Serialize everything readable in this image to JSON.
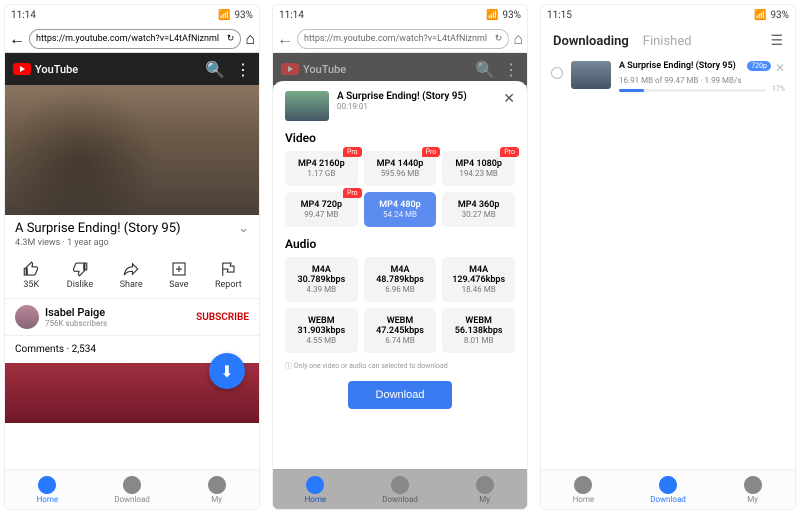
{
  "screen1": {
    "status_time": "11:14",
    "status_battery": "93%",
    "url": "https://m.youtube.com/watch?v=L4tAfNiznml",
    "yt_brand": "YouTube",
    "video_title": "A Surprise Ending! (Story 95)",
    "views": "4.3M views",
    "age": "1 year ago",
    "actions": [
      {
        "label": "35K"
      },
      {
        "label": "Dislike"
      },
      {
        "label": "Share"
      },
      {
        "label": "Save"
      },
      {
        "label": "Report"
      }
    ],
    "channel_name": "Isabel Paige",
    "channel_subs": "756K subscribers",
    "subscribe_label": "SUBSCRIBE",
    "comments_label": "Comments",
    "comments_count": "2,534",
    "nav": [
      "Home",
      "Download",
      "My"
    ]
  },
  "screen2": {
    "status_time": "11:14",
    "status_battery": "93%",
    "url": "https://m.youtube.com/watch?v=L4tAfNiznml",
    "sheet_title": "A Surprise Ending! (Story 95)",
    "duration": "00:19:01",
    "video_section": "Video",
    "video_opts": [
      {
        "fmt": "MP4 2160p",
        "sz": "1.17 GB",
        "pro": true
      },
      {
        "fmt": "MP4 1440p",
        "sz": "595.96 MB",
        "pro": true
      },
      {
        "fmt": "MP4 1080p",
        "sz": "194.23 MB",
        "pro": true
      },
      {
        "fmt": "MP4 720p",
        "sz": "99.47 MB",
        "pro": true
      },
      {
        "fmt": "MP4 480p",
        "sz": "54.24 MB",
        "selected": true
      },
      {
        "fmt": "MP4 360p",
        "sz": "30.27 MB"
      }
    ],
    "audio_section": "Audio",
    "audio_opts": [
      {
        "fmt": "M4A 30.789kbps",
        "sz": "4.39 MB"
      },
      {
        "fmt": "M4A 48.789kbps",
        "sz": "6.96 MB"
      },
      {
        "fmt": "M4A 129.476kbps",
        "sz": "18.46 MB"
      },
      {
        "fmt": "WEBM 31.903kbps",
        "sz": "4.55 MB"
      },
      {
        "fmt": "WEBM 47.245kbps",
        "sz": "6.74 MB"
      },
      {
        "fmt": "WEBM 56.138kbps",
        "sz": "8.01 MB"
      }
    ],
    "note": "Only one video or audio can selected to download",
    "download_label": "Download",
    "nav": [
      "Home",
      "Download",
      "My"
    ]
  },
  "screen3": {
    "status_time": "11:15",
    "status_battery": "93%",
    "tab_downloading": "Downloading",
    "tab_finished": "Finished",
    "item_title": "A Surprise Ending! (Story 95)",
    "item_badge": "720p",
    "item_progress": "16.91 MB of 99.47 MB · 1.99 MB/s",
    "item_percent": "17%",
    "nav": [
      "Home",
      "Download",
      "My"
    ]
  }
}
